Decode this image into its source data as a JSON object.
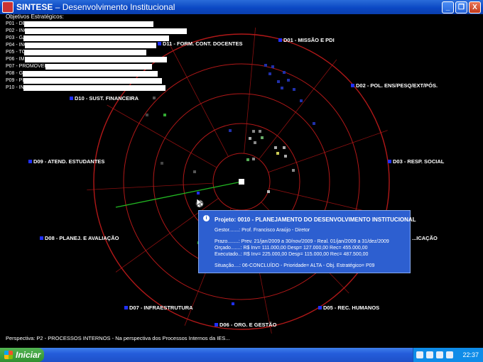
{
  "window": {
    "app_name": "SINTESE",
    "title_rest": " – Desenvolvimento Institucional",
    "buttons": [
      "_",
      "❐",
      "X"
    ]
  },
  "legend": {
    "title": "Objetivos Estratégicos:",
    "items": [
      "P01 - DESE",
      "P02 - INCE",
      "P03 - GAR",
      "P04 - INCE",
      "P05 - TORI",
      "P06 - IMPLE",
      "P07 - PROMOVER",
      "P08 - GAR",
      "P09 - PLAN",
      "P10 - INCO"
    ]
  },
  "dimensions": [
    {
      "id": "D01",
      "label": "D01 - MISSÃO E PDI"
    },
    {
      "id": "D02",
      "label": "D02 - POL. ENS/PESQ/EXT/PÓS."
    },
    {
      "id": "D03",
      "label": "D03 - RESP. SOCIAL"
    },
    {
      "id": "D04",
      "label": "...ICAÇÃO"
    },
    {
      "id": "D05",
      "label": "D05 - REC. HUMANOS"
    },
    {
      "id": "D06",
      "label": "D06 - ORG. E GESTÃO"
    },
    {
      "id": "D07",
      "label": "D07 - INFRAESTRUTURA"
    },
    {
      "id": "D08",
      "label": "D08 - PLANEJ. E AVALIAÇÃO"
    },
    {
      "id": "D09",
      "label": "D09 - ATEND. ESTUDANTES"
    },
    {
      "id": "D10",
      "label": "D10 - SUST. FINANCEIRA"
    },
    {
      "id": "D11",
      "label": "D11 - FORM. CONT. DOCENTES"
    }
  ],
  "colors": {
    "ring": "#b01818",
    "spoke": "#8a1010",
    "selector_line": "#22b822",
    "dimension_marker": "#2030ff"
  },
  "tooltip": {
    "title": "Projeto:  0010  -  PLANEJAMENTO DO DESENVOLVIMENTO INSTITUCIONAL",
    "gestor": "Gestor.......: Prof. Francisco Araújo - Diretor",
    "prazo": "Prazo........: Prev. 21/jan/2009 a 30/nov/2009  - Real. 01/jan/2009 a 31/dez/2009",
    "orcado": "Orçado.......: R$  Inv= 111.000,00   Desp= 127.000,00   Rec= 455.000,00",
    "executado": "Executado..: R$  Inv= 225.000,00   Desp= 115.000,00   Rec= 487.500,00",
    "situacao": "Situação....: 06-CONCLUÍDO   -  Prioridade= ALTA   -  Obj. Estratégico= P09"
  },
  "perspective": "Perspectiva: P2 - PROCESSOS INTERNOS - Na perspectiva dos Processos Internos da IES...",
  "taskbar": {
    "start_label": "Iniciar",
    "clock": "22:37"
  }
}
